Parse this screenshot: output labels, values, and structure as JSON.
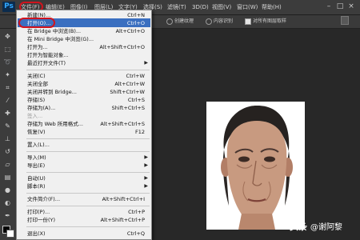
{
  "menubar": {
    "logo": "Ps",
    "items": [
      "文件(F)",
      "编辑(E)",
      "图像(I)",
      "图层(L)",
      "文字(Y)",
      "选择(S)",
      "滤镜(T)",
      "3D(D)",
      "视图(V)",
      "窗口(W)",
      "帮助(H)"
    ]
  },
  "optionsbar": {
    "item1": "创建纹理",
    "item2": "内容识别",
    "item3": "对所有图层取样"
  },
  "file_menu": {
    "items": [
      {
        "label": "新建(N)...",
        "shortcut": "Ctrl+N"
      },
      {
        "label": "打开(O)...",
        "shortcut": "Ctrl+O"
      },
      {
        "label": "在 Bridge 中浏览(B)...",
        "shortcut": "Alt+Ctrl+O"
      },
      {
        "label": "在 Mini Bridge 中浏览(G)...",
        "shortcut": ""
      },
      {
        "label": "打开为...",
        "shortcut": "Alt+Shift+Ctrl+O"
      },
      {
        "label": "打开为智能对象...",
        "shortcut": ""
      },
      {
        "label": "最近打开文件(T)",
        "shortcut": ""
      },
      {
        "label": "关闭(C)",
        "shortcut": "Ctrl+W"
      },
      {
        "label": "关闭全部",
        "shortcut": "Alt+Ctrl+W"
      },
      {
        "label": "关闭并转到 Bridge...",
        "shortcut": "Shift+Ctrl+W"
      },
      {
        "label": "存储(S)",
        "shortcut": "Ctrl+S"
      },
      {
        "label": "存储为(A)...",
        "shortcut": "Shift+Ctrl+S"
      },
      {
        "label": "签入...",
        "shortcut": ""
      },
      {
        "label": "存储为 Web 所用格式...",
        "shortcut": "Alt+Shift+Ctrl+S"
      },
      {
        "label": "恢复(V)",
        "shortcut": "F12"
      },
      {
        "label": "置入(L)...",
        "shortcut": ""
      },
      {
        "label": "导入(M)",
        "shortcut": ""
      },
      {
        "label": "导出(E)",
        "shortcut": ""
      },
      {
        "label": "自动(U)",
        "shortcut": ""
      },
      {
        "label": "脚本(R)",
        "shortcut": ""
      },
      {
        "label": "文件简介(F)...",
        "shortcut": "Alt+Shift+Ctrl+I"
      },
      {
        "label": "打印(P)...",
        "shortcut": "Ctrl+P"
      },
      {
        "label": "打印一份(Y)",
        "shortcut": "Alt+Shift+Ctrl+P"
      },
      {
        "label": "退出(X)",
        "shortcut": "Ctrl+Q"
      }
    ]
  },
  "watermark": {
    "text": "头条",
    "handle": "@谢阿黎"
  },
  "colors": {
    "accent_highlight": "#3a6fc0",
    "annotation_red": "#d0141e",
    "menubar_bg": "#3c3c3c",
    "canvas_bg": "#282828"
  }
}
